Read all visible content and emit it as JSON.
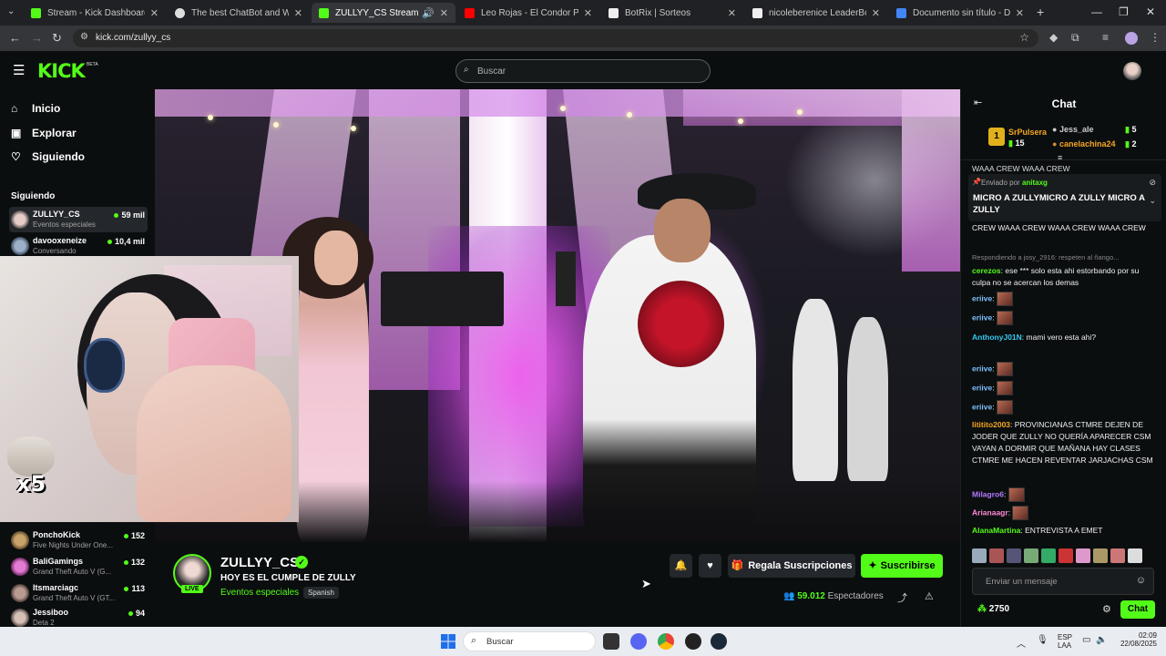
{
  "browser": {
    "tabs": [
      {
        "title": "Stream - Kick Dashboard",
        "active": false
      },
      {
        "title": "The best ChatBot and Widgets",
        "active": false
      },
      {
        "title": "ZULLYY_CS Stream - Watch",
        "active": true
      },
      {
        "title": "Leo Rojas - El Condor Pasa (Vid",
        "active": false
      },
      {
        "title": "BotRix | Sorteos",
        "active": false
      },
      {
        "title": "nicoleberenice LeaderBoard | Ti",
        "active": false
      },
      {
        "title": "Documento sin título - Docum",
        "active": false
      }
    ],
    "url": "kick.com/zullyy_cs",
    "new_tab": "+"
  },
  "topnav": {
    "logo": "KICK",
    "beta": "BETA",
    "search_placeholder": "Buscar"
  },
  "sidebar": {
    "menu": [
      {
        "label": "Inicio",
        "icon": "home-icon"
      },
      {
        "label": "Explorar",
        "icon": "compass-icon"
      },
      {
        "label": "Siguiendo",
        "icon": "heart-icon"
      }
    ],
    "following_heading": "Siguiendo",
    "channels": [
      {
        "name": "ZULLYY_CS",
        "category": "Eventos especiales",
        "viewers": "59 mil",
        "selected": true
      },
      {
        "name": "davooxeneize",
        "category": "Conversando",
        "viewers": "10,4 mil",
        "selected": false
      },
      {
        "name": "PonchoKick",
        "category": "Five Nights Under One...",
        "viewers": "152",
        "selected": false
      },
      {
        "name": "BaliGamings",
        "category": "Grand Theft Auto V (G...",
        "viewers": "132",
        "selected": false
      },
      {
        "name": "Itsmarciagc",
        "category": "Grand Theft Auto V (GT...",
        "viewers": "113",
        "selected": false
      },
      {
        "name": "Jessiboo",
        "category": "Deta 2",
        "viewers": "94",
        "selected": false
      }
    ]
  },
  "webcam": {
    "overlay_text": "x5"
  },
  "stream": {
    "channel": "ZULLYY_CS",
    "live": "LIVE",
    "title": "HOY ES EL CUMPLE DE ZULLY",
    "category": "Eventos especiales",
    "language": "Spanish",
    "gift_label": "Regala Suscripciones",
    "subscribe_label": "Suscribirse",
    "viewers_count": "59.012",
    "viewers_label": "Espectadores"
  },
  "chat": {
    "title": "Chat",
    "leaderboard": [
      {
        "rank": "1",
        "name": "SrPulsera",
        "value": "15"
      },
      {
        "name": "Jess_ale",
        "value": "5"
      },
      {
        "name": "canelachina24",
        "value": "2"
      }
    ],
    "overflow_top": "WAAA CREW  WAAA CREW",
    "pinned_by_label": "Enviado por",
    "pinned_by_user": "anitaxg",
    "pinned_message": "MICRO A ZULLYMICRO A ZULLY MICRO A ZULLY",
    "messages": [
      {
        "user": "",
        "text": "CREW  WAAA CREW  WAAA CREW  WAAA CREW",
        "color": "#efeff1"
      },
      {
        "user": "",
        "text": "Respondiendo a josy_2916: respeten al ñango...",
        "color": "#888888",
        "reply": true
      },
      {
        "user": "cerezos",
        "text": "ese *** solo esta ahi estorbando por su culpa no se acercan los demas",
        "color": "#53fc18"
      },
      {
        "user": "eriive",
        "text": "",
        "color": "#7ec0ff",
        "emote": true
      },
      {
        "user": "eriive",
        "text": "",
        "color": "#7ec0ff",
        "emote": true
      },
      {
        "user": "AnthonyJ01N",
        "text": "mami vero esta ahi?",
        "color": "#35c9f0"
      },
      {
        "user": "eriive",
        "text": "",
        "color": "#7ec0ff",
        "emote": true
      },
      {
        "user": "eriive",
        "text": "",
        "color": "#7ec0ff",
        "emote": true
      },
      {
        "user": "eriive",
        "text": "",
        "color": "#7ec0ff",
        "emote": true
      },
      {
        "user": "lititito2003",
        "text": "PROVINCIANAS CTMRE DEJEN DE JODER QUE ZULLY NO QUERÍA APARECER CSM VAYAN A DORMIR QUE MAÑANA HAY CLASES CTMRE ME HACEN REVENTAR JARJACHAS CSM",
        "color": "#f5a623"
      },
      {
        "user": "Milagro6",
        "text": "",
        "color": "#b57bff",
        "emote": true
      },
      {
        "user": "Arianaagr",
        "text": "",
        "color": "#ff8ad8",
        "emote": true
      },
      {
        "user": "AlanaMartina",
        "text": "ENTREVISTA A EMET",
        "color": "#53fc18"
      }
    ],
    "input_placeholder": "Enviar un mensaje",
    "points": "2750",
    "chat_button": "Chat"
  },
  "taskbar": {
    "search_placeholder": "Buscar",
    "lang_top": "ESP",
    "lang_bottom": "LAA",
    "time": "02:09",
    "date": "22/08/2025"
  },
  "colors": {
    "accent": "#53fc18",
    "background": "#0b0e0f"
  }
}
